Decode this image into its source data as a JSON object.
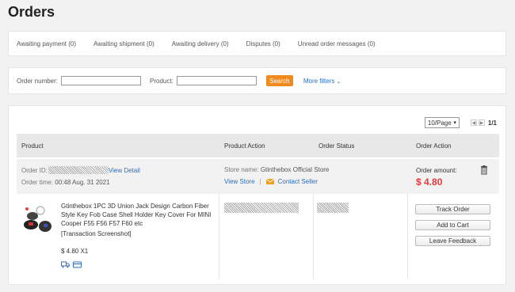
{
  "page": {
    "title": "Orders"
  },
  "tabs": [
    "Awaiting payment (0)",
    "Awaiting shipment (0)",
    "Awaiting delivery (0)",
    "Disputes (0)",
    "Unread order messages (0)"
  ],
  "filters": {
    "order_number_label": "Order number:",
    "product_label": "Product:",
    "search_label": "Search",
    "more_filters_label": "More filters",
    "more_filters_icon": "chevron-down-icon"
  },
  "pager": {
    "page_size": "10/Page",
    "page_count": "1/1"
  },
  "table_headers": {
    "product": "Product",
    "product_action": "Product Action",
    "order_status": "Order Status",
    "order_action": "Order Action"
  },
  "order": {
    "id_label": "Order ID:",
    "view_detail": "View Detail",
    "time_label": "Order time:",
    "time_value": "00:48 Aug. 31 2021",
    "store_label": "Store name:",
    "store_name": "Gtinthebox Official Store",
    "view_store": "View Store",
    "separator": "|",
    "contact_seller": "Contact Seller",
    "amount_label": "Order amount:",
    "amount_value": "$ 4.80",
    "delete_icon": "trash-icon",
    "product": {
      "title": "Gtinthebox 1PC 3D Union Jack Design Carbon Fiber Style Key Fob Case Shell Holder Key Cover For MINI Cooper F55 F56 F57 F60 etc",
      "snapshot": "[Transaction Screenshot]",
      "price_qty": "$ 4.80 X1"
    },
    "actions": [
      "Track Order",
      "Add to Cart",
      "Leave Feedback"
    ]
  },
  "colors": {
    "accent": "#f08a1e",
    "link": "#2a6ebb",
    "price": "#e4393c"
  }
}
